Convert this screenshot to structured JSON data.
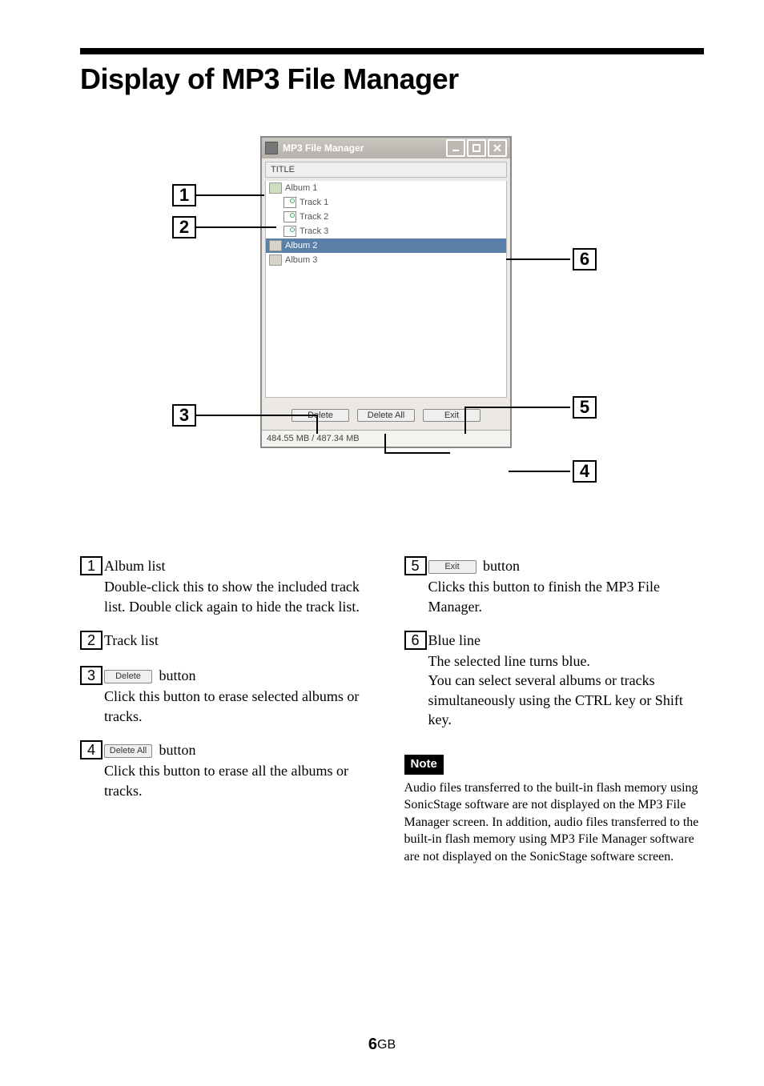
{
  "page": {
    "title": "Display of MP3 File Manager",
    "number": "6",
    "region": "GB"
  },
  "app": {
    "window_title": "MP3 File Manager",
    "column_header": "TITLE",
    "tree": {
      "album1": "Album 1",
      "track1": "Track 1",
      "track2": "Track 2",
      "track3": "Track 3",
      "album2": "Album 2",
      "album3": "Album 3"
    },
    "buttons": {
      "delete": "Delete",
      "delete_all": "Delete All",
      "exit": "Exit"
    },
    "status": "484.55 MB / 487.34 MB"
  },
  "callouts": {
    "n1": "1",
    "n2": "2",
    "n3": "3",
    "n4": "4",
    "n5": "5",
    "n6": "6"
  },
  "desc": {
    "i1_title": "Album list",
    "i1_body": "Double-click this to show the included track list. Double click again to hide the track list.",
    "i2_title": "Track list",
    "i3_suffix": " button",
    "i3_body": "Click this button to erase selected albums or tracks.",
    "i4_suffix": " button",
    "i4_body": "Click this button to erase all the albums or tracks.",
    "i5_suffix": " button",
    "i5_body": "Clicks this button to finish the MP3 File Manager.",
    "i6_title": "Blue line",
    "i6_body1": "The selected line turns blue.",
    "i6_body2": "You can select several albums or tracks simultaneously using the CTRL key or Shift key.",
    "note_label": "Note",
    "note_body": "Audio files transferred to the built-in flash memory using SonicStage software are not displayed on the MP3 File Manager screen. In addition, audio files transferred to the built-in flash memory using MP3 File Manager software are not displayed on the SonicStage software screen."
  }
}
